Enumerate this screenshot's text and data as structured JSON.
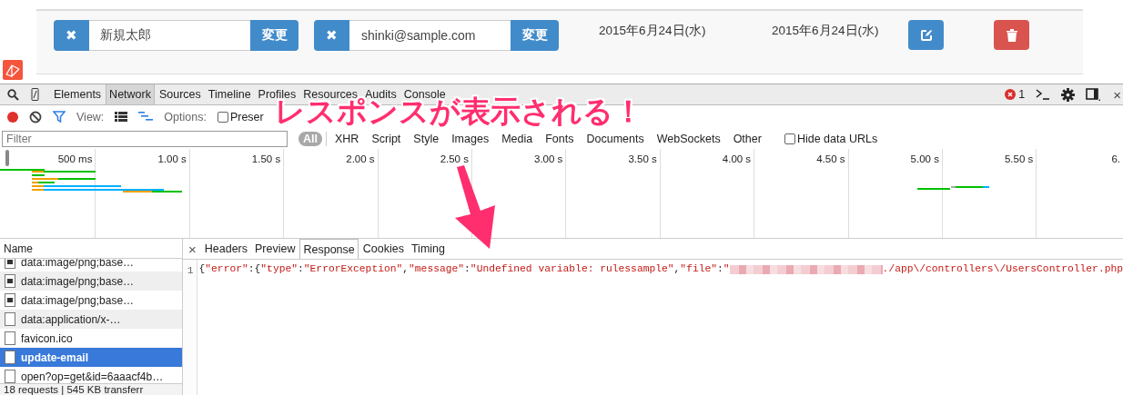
{
  "page_row": {
    "name_field": {
      "clear": "✖",
      "value": "新規太郎",
      "submit": "変更"
    },
    "email_field": {
      "clear": "✖",
      "value": "shinki@sample.com",
      "submit": "変更"
    },
    "created": "2015年6月24日(水)",
    "updated": "2015年6月24日(水)"
  },
  "devtools": {
    "tabs": [
      {
        "label": "Elements",
        "selected": false
      },
      {
        "label": "Network",
        "selected": true
      },
      {
        "label": "Sources",
        "selected": false
      },
      {
        "label": "Timeline",
        "selected": false
      },
      {
        "label": "Profiles",
        "selected": false
      },
      {
        "label": "Resources",
        "selected": false
      },
      {
        "label": "Audits",
        "selected": false
      },
      {
        "label": "Console",
        "selected": false
      }
    ],
    "error_count": "1",
    "close": "×",
    "toolbar": {
      "recording": true,
      "view_label": "View:",
      "options_label": "Options:",
      "preserve_log": {
        "label": "Preser",
        "checked": false
      }
    },
    "filter": {
      "placeholder": "Filter",
      "types": [
        {
          "label": "All",
          "selected": true
        },
        {
          "label": "XHR",
          "selected": false
        },
        {
          "label": "Script",
          "selected": false
        },
        {
          "label": "Style",
          "selected": false
        },
        {
          "label": "Images",
          "selected": false
        },
        {
          "label": "Media",
          "selected": false
        },
        {
          "label": "Fonts",
          "selected": false
        },
        {
          "label": "Documents",
          "selected": false
        },
        {
          "label": "WebSockets",
          "selected": false
        },
        {
          "label": "Other",
          "selected": false
        }
      ],
      "hide_data_urls": {
        "label": "Hide data URLs",
        "checked": false
      }
    },
    "overview_ticks": [
      "500 ms",
      "1.00 s",
      "1.50 s",
      "2.00 s",
      "2.50 s",
      "3.00 s",
      "3.50 s",
      "4.00 s",
      "4.50 s",
      "5.00 s",
      "5.50 s",
      "6."
    ],
    "requests": {
      "header": "Name",
      "items": [
        {
          "name": "data:image/png;base…",
          "kind": "image",
          "selected": false
        },
        {
          "name": "data:image/png;base…",
          "kind": "image",
          "selected": false
        },
        {
          "name": "data:image/png;base…",
          "kind": "image",
          "selected": false
        },
        {
          "name": "data:application/x-…",
          "kind": "document",
          "selected": false
        },
        {
          "name": "favicon.ico",
          "kind": "document",
          "selected": false
        },
        {
          "name": "update-email",
          "kind": "document",
          "selected": true
        },
        {
          "name": "open?op=get&id=6aaacf4b…",
          "kind": "document",
          "selected": false
        }
      ],
      "summary": "18 requests | 545 KB transferr"
    },
    "detail_close": "×",
    "detail_tabs": [
      {
        "label": "Headers",
        "selected": false
      },
      {
        "label": "Preview",
        "selected": false
      },
      {
        "label": "Response",
        "selected": true
      },
      {
        "label": "Cookies",
        "selected": false
      },
      {
        "label": "Timing",
        "selected": false
      }
    ],
    "response": {
      "line_number": "1",
      "before": [
        {
          "text": "{",
          "kind": "punct"
        },
        {
          "text": "\"error\"",
          "kind": "string"
        },
        {
          "text": ":{",
          "kind": "punct"
        },
        {
          "text": "\"type\"",
          "kind": "string"
        },
        {
          "text": ":",
          "kind": "punct"
        },
        {
          "text": "\"ErrorException\"",
          "kind": "string"
        },
        {
          "text": ",",
          "kind": "punct"
        },
        {
          "text": "\"message\"",
          "kind": "string"
        },
        {
          "text": ":",
          "kind": "punct"
        },
        {
          "text": "\"Undefined variable: rulessample\"",
          "kind": "string"
        },
        {
          "text": ",",
          "kind": "punct"
        },
        {
          "text": "\"file\"",
          "kind": "string"
        },
        {
          "text": ":",
          "kind": "punct"
        },
        {
          "text": "\"",
          "kind": "string"
        }
      ],
      "redacted": true,
      "after": [
        {
          "text": "./app\\/controllers\\/UsersController.php",
          "kind": "string"
        }
      ]
    }
  },
  "annotation": {
    "text": "レスポンスが表示される！"
  }
}
